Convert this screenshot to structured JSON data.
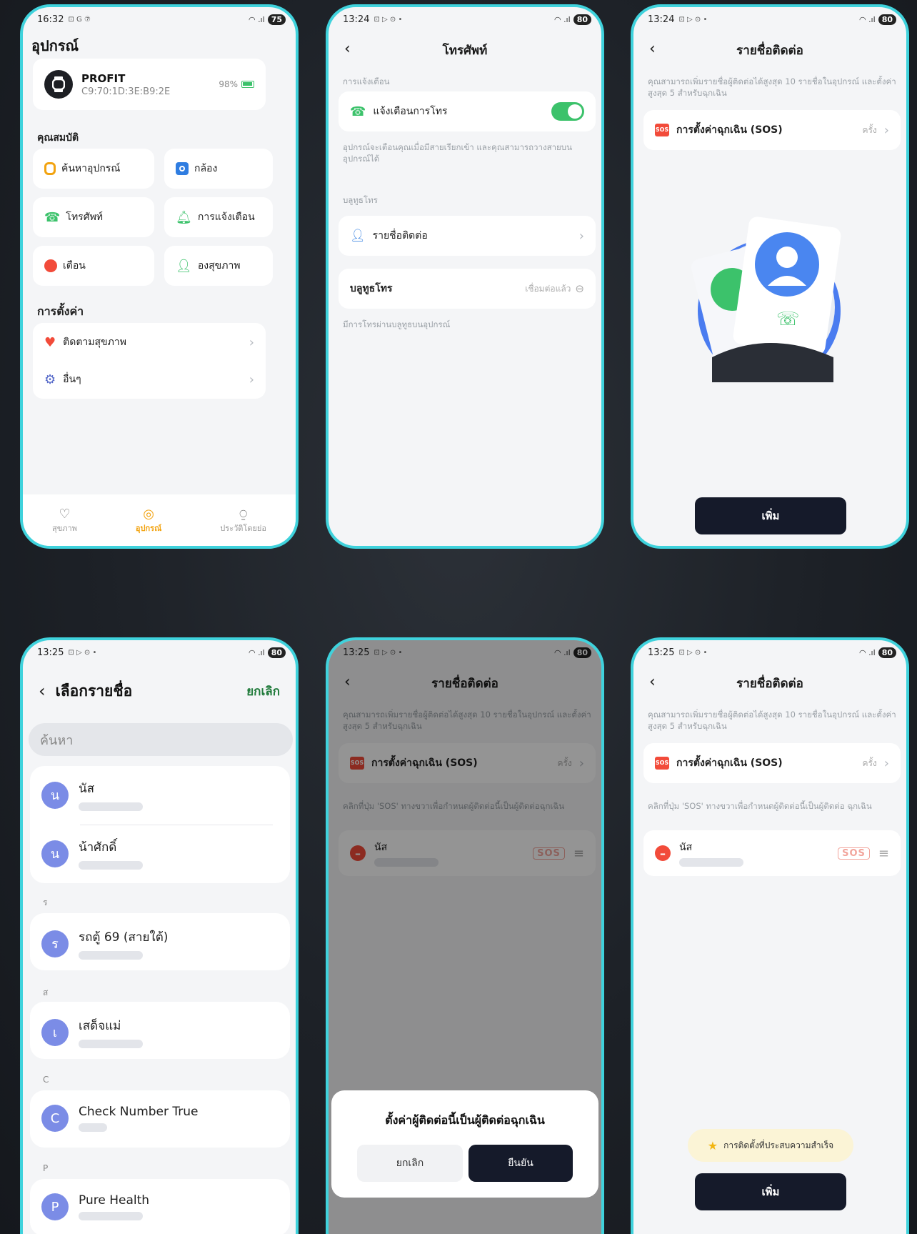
{
  "screens": {
    "device": {
      "time": "16:32",
      "status_icons": "⊡ G ⑦",
      "battery": "75",
      "page_title": "อุปกรณ์",
      "device_name": "PROFIT",
      "device_mac": "C9:70:1D:3E:B9:2E",
      "device_battery": "98%",
      "features_title": "คุณสมบัติ",
      "tiles": {
        "find_device": "ค้นหาอุปกรณ์",
        "camera": "กล้อง",
        "phone": "โทรศัพท์",
        "notifications": "การแจ้งเตือน",
        "alarm": "เตือน",
        "health": "องสุขภาพ"
      },
      "settings_title": "การตั้งค่า",
      "settings_rows": {
        "health_monitor": "ติดตามสุขภาพ",
        "others": "อื่นๆ"
      },
      "bottom_nav": {
        "health": "สุขภาพ",
        "device": "อุปกรณ์",
        "profile": "ประวัติโดยย่อ"
      }
    },
    "phone": {
      "time": "13:24",
      "status_icons": "⊡ ▷ ⊙ •",
      "battery": "80",
      "title": "โทรศัพท์",
      "notify_section": "การแจ้งเตือน",
      "call_alert_label": "แจ้งเตือนการโทร",
      "call_alert_on": true,
      "notify_desc": "อุปกรณ์จะเตือนคุณเมื่อมีสายเรียกเข้า และคุณสามารถวางสายบนอุปกรณ์ได้",
      "bt_section": "บลูทูธโทร",
      "contacts_row": "รายชื่อติดต่อ",
      "bt_row_label": "บลูทูธโทร",
      "bt_row_status": "เชื่อมต่อแล้ว",
      "bt_desc": "มีการโทรผ่านบลูทูธบนอุปกรณ์"
    },
    "contacts_empty": {
      "time": "13:24",
      "status_icons": "⊡ ▷ ⊙ •",
      "battery": "80",
      "title": "รายชื่อติดต่อ",
      "desc": "คุณสามารถเพิ่มรายชื่อผู้ติดต่อได้สูงสุด 10 รายชื่อในอุปกรณ์ และตั้งค่าสูงสุด 5 สำหรับฉุกเฉิน",
      "sos_row": "การตั้งค่าฉุกเฉิน (SOS)",
      "sos_mode": "ครั้ง",
      "add_button": "เพิ่ม"
    },
    "select_contacts": {
      "time": "13:25",
      "status_icons": "⊡ ▷ ⊙ •",
      "battery": "80",
      "title": "เลือกรายชื่อ",
      "cancel": "ยกเลิก",
      "search_placeholder": "ค้นหา",
      "groups": [
        {
          "letter": "",
          "contacts": [
            {
              "initial": "น",
              "name": "นัส"
            },
            {
              "initial": "น",
              "name": "น้าศักดิ์"
            }
          ]
        },
        {
          "letter": "ร",
          "contacts": [
            {
              "initial": "ร",
              "name": "รถตู้ 69 (สายใต้)"
            }
          ]
        },
        {
          "letter": "ส",
          "contacts": [
            {
              "initial": "เ",
              "name": "เสด็จแม่"
            }
          ]
        },
        {
          "letter": "C",
          "contacts": [
            {
              "initial": "C",
              "name": "Check Number True"
            }
          ]
        },
        {
          "letter": "P",
          "contacts": [
            {
              "initial": "P",
              "name": "Pure Health"
            }
          ]
        }
      ]
    },
    "confirm_dialog": {
      "time": "13:25",
      "status_icons": "⊡ ▷ ⊙ •",
      "battery": "80",
      "title": "รายชื่อติดต่อ",
      "desc": "คุณสามารถเพิ่มรายชื่อผู้ติดต่อได้สูงสุด 10 รายชื่อในอุปกรณ์ และตั้งค่าสูงสุด 5 สำหรับฉุกเฉิน",
      "sos_row": "การตั้งค่าฉุกเฉิน (SOS)",
      "sos_mode": "ครั้ง",
      "hint": "คลิกที่ปุ่ม 'SOS' ทางขวาเพื่อกำหนดผู้ติดต่อนี้เป็นผู้ติดต่อฉุกเฉิน",
      "contact_name": "นัส",
      "sos_tag": "SOS",
      "dialog_title": "ตั้งค่าผู้ติดต่อนี้เป็นผู้ติดต่อฉุกเฉิน",
      "dialog_cancel": "ยกเลิก",
      "dialog_confirm": "ยืนยัน"
    },
    "contacts_success": {
      "time": "13:25",
      "status_icons": "⊡ ▷ ⊙ •",
      "battery": "80",
      "title": "รายชื่อติดต่อ",
      "desc": "คุณสามารถเพิ่มรายชื่อผู้ติดต่อได้สูงสุด 10 รายชื่อในอุปกรณ์ และตั้งค่าสูงสุด 5 สำหรับฉุกเฉิน",
      "sos_row": "การตั้งค่าฉุกเฉิน (SOS)",
      "sos_mode": "ครั้ง",
      "hint": "คลิกที่ปุ่ม 'SOS' ทางขวาเพื่อกำหนดผู้ติดต่อนี้เป็นผู้ติดต่อ ฉุกเฉิน",
      "contact_name": "นัส",
      "sos_tag": "SOS",
      "toast": "การติดตั้งที่ประสบความสำเร็จ",
      "add_button": "เพิ่ม"
    }
  },
  "colors": {
    "frame": "#3fd2dc",
    "accent_green": "#3cc26b",
    "dark_button": "#151a2a",
    "sos_red": "#f24b3a",
    "device_orange": "#f2a310"
  }
}
